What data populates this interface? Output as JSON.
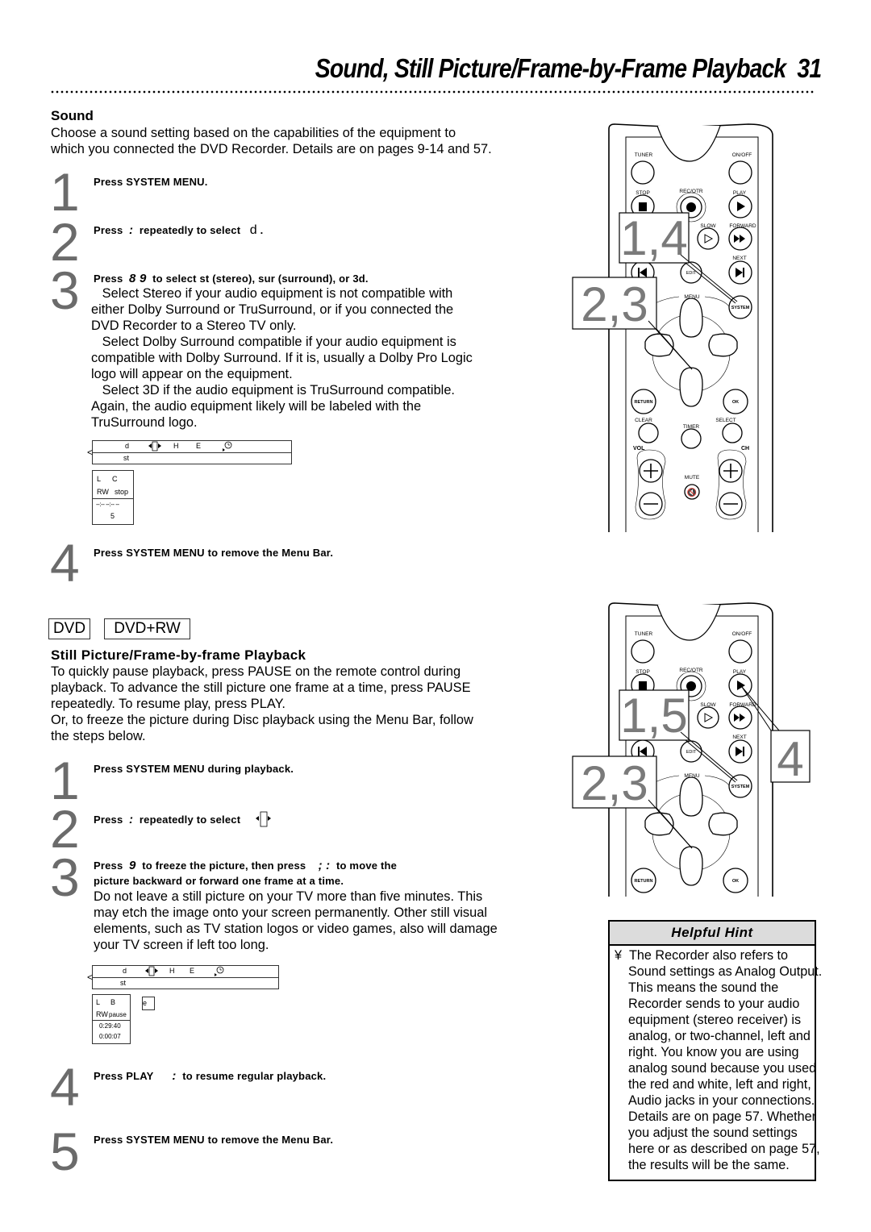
{
  "page": {
    "title": "Sound, Still Picture/Frame-by-Frame Playback",
    "page_number": "31"
  },
  "sound": {
    "heading": "Sound",
    "intro": [
      "Choose a sound setting based on the capabilities of the equipment to",
      "which you connected the DVD Recorder. Details are on pages 9-14 and 57."
    ],
    "steps": [
      {
        "num": "1",
        "text": "Press SYSTEM MENU."
      },
      {
        "num": "2",
        "text_a": "Press",
        "sym": ":",
        "text_b": "repeatedly to select",
        "target": "d",
        "end": "."
      },
      {
        "num": "3",
        "text_a": "Press",
        "sym": "8 9",
        "text_b": "to select st (stereo), sur (surround), or 3d.",
        "detail": [
          "   Select Stereo if your audio equipment is not compatible with",
          "either Dolby Surround or TruSurround, or if you connected the",
          "DVD Recorder to a Stereo TV only.",
          "   Select Dolby Surround compatible if your audio equipment is",
          "compatible with Dolby Surround. If it is, usually a Dolby Pro Logic",
          "logo will appear on the equipment.",
          "   Select 3D if the audio equipment is TruSurround compatible.",
          "Again, the audio equipment likely will be labeled with the",
          "TruSurround logo."
        ]
      },
      {
        "num": "4",
        "text": "Press SYSTEM MENU to remove the Menu Bar."
      }
    ],
    "menu_bar": {
      "items": [
        "d",
        "H",
        "E"
      ],
      "sub_value": "st"
    },
    "status": {
      "row1": [
        "L",
        "C"
      ],
      "row2": [
        "RW",
        "stop"
      ],
      "time": "--:-- --:-- --",
      "count": "5"
    }
  },
  "still": {
    "disc_badges": [
      "DVD",
      "DVD+RW"
    ],
    "heading": "Still Picture/Frame-by-frame Playback",
    "intro": [
      "To quickly pause playback, press PAUSE on the remote control during",
      "playback. To advance the still picture one frame at a time, press PAUSE",
      "repeatedly. To resume play, press PLAY.",
      "Or, to freeze the picture during Disc playback using the Menu Bar, follow",
      "the steps below."
    ],
    "steps": [
      {
        "num": "1",
        "text": "Press SYSTEM MENU during playback."
      },
      {
        "num": "2",
        "text_a": "Press",
        "sym": ":",
        "text_b": "repeatedly to select"
      },
      {
        "num": "3",
        "text_a": "Press",
        "sym": "9",
        "text_b": "to freeze the picture, then press",
        "sym2": "; :",
        "text_c": "to move the",
        "line2": "picture backward or forward one frame at a time.",
        "detail": [
          "Do not leave a still picture on your TV more than five minutes. This",
          "may etch the image onto your screen permanently. Other still visual",
          "elements, such as TV station logos or video games, also will damage",
          "your TV screen if left too long."
        ]
      },
      {
        "num": "4",
        "text_a": "Press PLAY",
        "sym": ":",
        "text_b": "to resume regular playback."
      },
      {
        "num": "5",
        "text": "Press SYSTEM MENU to remove the Menu Bar."
      }
    ],
    "menu_bar": {
      "items": [
        "d",
        "H",
        "E"
      ],
      "sub_value": "st"
    },
    "status": {
      "row1": [
        "L",
        "B"
      ],
      "row2": [
        "RW",
        "pause"
      ],
      "time1": "0:29:40",
      "time2": "0:00:07"
    },
    "frame_indicator": "e"
  },
  "remote_top": {
    "labels": {
      "tuner": "TUNER",
      "onoff": "ON/OFF",
      "stop": "STOP",
      "rec": "REC/OTR",
      "play": "PLAY",
      "slow": "SLOW",
      "forward": "FORWARD",
      "next": "NEXT",
      "edit": "EDIT",
      "menu": "MENU",
      "system": "SYSTEM",
      "return": "RETURN",
      "ok": "OK",
      "clear": "CLEAR",
      "timer": "TIMER",
      "select": "SELECT",
      "vol": "VOL",
      "ch": "CH",
      "mute": "MUTE"
    },
    "callouts": [
      "1,4",
      "2,3"
    ]
  },
  "remote_bottom": {
    "labels": {
      "tuner": "TUNER",
      "onoff": "ON/OFF",
      "stop": "STOP",
      "rec": "REC/OTR",
      "play": "PLAY",
      "slow": "SLOW",
      "forward": "FORWARD",
      "next": "NEXT",
      "edit": "EDIT",
      "menu": "MENU",
      "system": "SYSTEM",
      "return": "RETURN",
      "ok": "OK"
    },
    "callouts": [
      "1,5",
      "2,3",
      "4"
    ]
  },
  "hint": {
    "title": "Helpful Hint",
    "bullet": "¥",
    "lines": [
      "The Recorder also refers to",
      "Sound settings as Analog Output.",
      "This means the sound the",
      "Recorder sends to your audio",
      "equipment (stereo receiver) is",
      "analog, or two-channel, left and",
      "right. You know you are using",
      "analog sound because you used",
      "the red and white, left and right,",
      "Audio jacks in your connections.",
      "Details are on page 57. Whether",
      "you adjust the sound settings",
      "here or as described on page 57,",
      "the results will be the same."
    ]
  }
}
